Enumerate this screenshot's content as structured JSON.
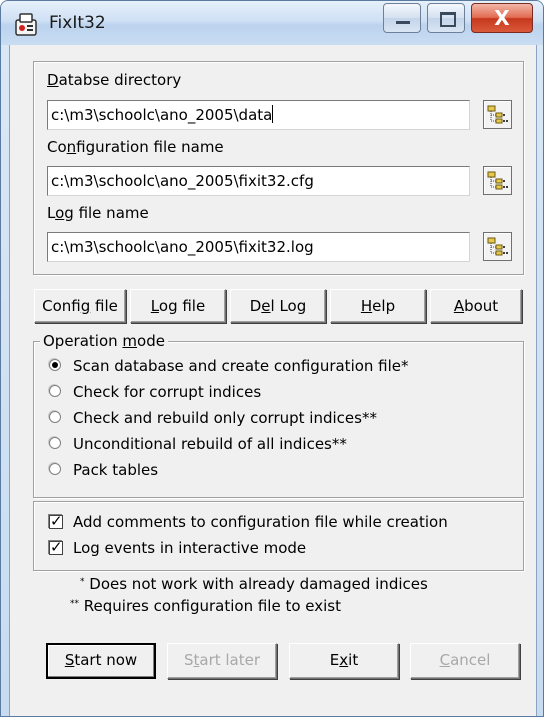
{
  "window": {
    "title": "FixIt32",
    "close_glyph": "X"
  },
  "paths": {
    "database": {
      "label_prefix": "",
      "label_key": "D",
      "label_rest": "atabse directory",
      "value": "c:\\m3\\schoolc\\ano_2005\\data"
    },
    "config": {
      "label_prefix": "Co",
      "label_key": "n",
      "label_rest": "figuration file name",
      "value": "c:\\m3\\schoolc\\ano_2005\\fixit32.cfg"
    },
    "log": {
      "label_prefix": "L",
      "label_key": "o",
      "label_rest": "g file name",
      "value": "c:\\m3\\schoolc\\ano_2005\\fixit32.log"
    }
  },
  "buttons": [
    {
      "pre": "Confi",
      "key": "g",
      "post": " file"
    },
    {
      "pre": "",
      "key": "L",
      "post": "og file"
    },
    {
      "pre": "D",
      "key": "e",
      "post": "l Log"
    },
    {
      "pre": "",
      "key": "H",
      "post": "elp"
    },
    {
      "pre": "",
      "key": "A",
      "post": "bout"
    }
  ],
  "operation_mode": {
    "legend_pre": "Operation ",
    "legend_key": "m",
    "legend_post": "ode",
    "selected_index": 0,
    "options": [
      "Scan database and create configuration file*",
      "Check for corrupt indices",
      "Check and rebuild only corrupt indices**",
      "Unconditional rebuild of all indices**",
      "Pack tables"
    ]
  },
  "options": {
    "add_comments": {
      "label": "Add comments to configuration file while creation",
      "checked": true
    },
    "log_events": {
      "label": "Log events in interactive mode",
      "checked": true
    },
    "check_mark": "✓"
  },
  "notes": {
    "single_star": "*",
    "single_text": " Does not work with already damaged indices",
    "double_star": "**",
    "double_text": " Requires configuration file to exist"
  },
  "footer_buttons": {
    "start_now": {
      "pre": "",
      "key": "S",
      "post": "tart now"
    },
    "start_later": {
      "pre": "S",
      "key": "t",
      "post": "art later"
    },
    "exit": {
      "pre": "E",
      "key": "x",
      "post": "it"
    },
    "cancel": {
      "pre": "",
      "key": "C",
      "post": "ancel"
    }
  }
}
